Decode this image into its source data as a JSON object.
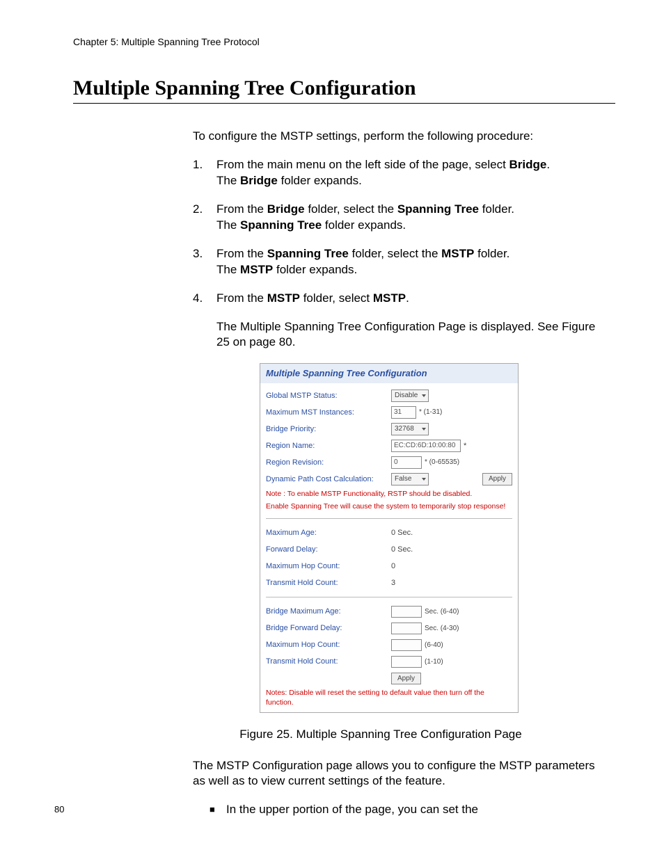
{
  "chapter_header": "Chapter 5: Multiple Spanning Tree Protocol",
  "section_title": "Multiple Spanning Tree Configuration",
  "intro": "To configure the MSTP settings, perform the following procedure:",
  "steps": [
    {
      "pre1": "From the main menu on the left side of the page, select ",
      "b1": "Bridge",
      "post1": ".",
      "line2_pre": "The ",
      "line2_b": "Bridge",
      "line2_post": " folder expands."
    },
    {
      "pre1": "From the ",
      "b1": "Bridge",
      "mid1": " folder, select the ",
      "b2": "Spanning Tree",
      "post1": " folder.",
      "line2_pre": "The ",
      "line2_b": "Spanning Tree",
      "line2_post": " folder expands."
    },
    {
      "pre1": "From the ",
      "b1": "Spanning Tree",
      "mid1": " folder, select the ",
      "b2": "MSTP",
      "post1": " folder.",
      "line2_pre": "The ",
      "line2_b": "MSTP",
      "line2_post": " folder expands."
    },
    {
      "pre1": "From the ",
      "b1": "MSTP",
      "mid1": " folder, select ",
      "b2": "MSTP",
      "post1": "."
    }
  ],
  "after_step4": "The Multiple Spanning Tree Configuration Page is displayed. See Figure 25 on page 80.",
  "figure": {
    "panel_title": "Multiple Spanning Tree Configuration",
    "section1": [
      {
        "label": "Global MSTP Status:",
        "type": "select",
        "value": "Disable"
      },
      {
        "label": "Maximum MST Instances:",
        "type": "text",
        "value": "31",
        "hint": "* (1-31)",
        "width": "sm"
      },
      {
        "label": "Bridge Priority:",
        "type": "select",
        "value": "32768"
      },
      {
        "label": "Region Name:",
        "type": "text",
        "value": "EC:CD:6D:10:00:80",
        "hint": "*",
        "width": "md"
      },
      {
        "label": "Region Revision:",
        "type": "text",
        "value": "0",
        "hint": "* (0-65535)",
        "width": "num"
      },
      {
        "label": "Dynamic Path Cost Calculation:",
        "type": "select",
        "value": "False",
        "apply": true
      }
    ],
    "note1a": "Note : To enable MSTP Functionality, RSTP should be disabled.",
    "note1b": "Enable Spanning Tree will cause the system to temporarily stop response!",
    "section2": [
      {
        "label": "Maximum Age:",
        "value": "0 Sec."
      },
      {
        "label": "Forward Delay:",
        "value": "0 Sec."
      },
      {
        "label": "Maximum Hop Count:",
        "value": "0"
      },
      {
        "label": "Transmit Hold Count:",
        "value": "3"
      }
    ],
    "section3": [
      {
        "label": "Bridge Maximum Age:",
        "hint": "Sec. (6-40)"
      },
      {
        "label": "Bridge Forward Delay:",
        "hint": "Sec. (4-30)"
      },
      {
        "label": "Maximum Hop Count:",
        "hint": "(6-40)"
      },
      {
        "label": "Transmit Hold Count:",
        "hint": "(1-10)"
      }
    ],
    "apply_label": "Apply",
    "note2": "Notes: Disable will reset the setting to default value then turn off the function."
  },
  "caption": "Figure 25. Multiple Spanning Tree Configuration Page",
  "para_after_caption": "The MSTP Configuration page allows you to configure the MSTP parameters as well as to view current settings of the feature.",
  "bullet": "In the upper portion of the page, you can set the",
  "page_number": "80"
}
